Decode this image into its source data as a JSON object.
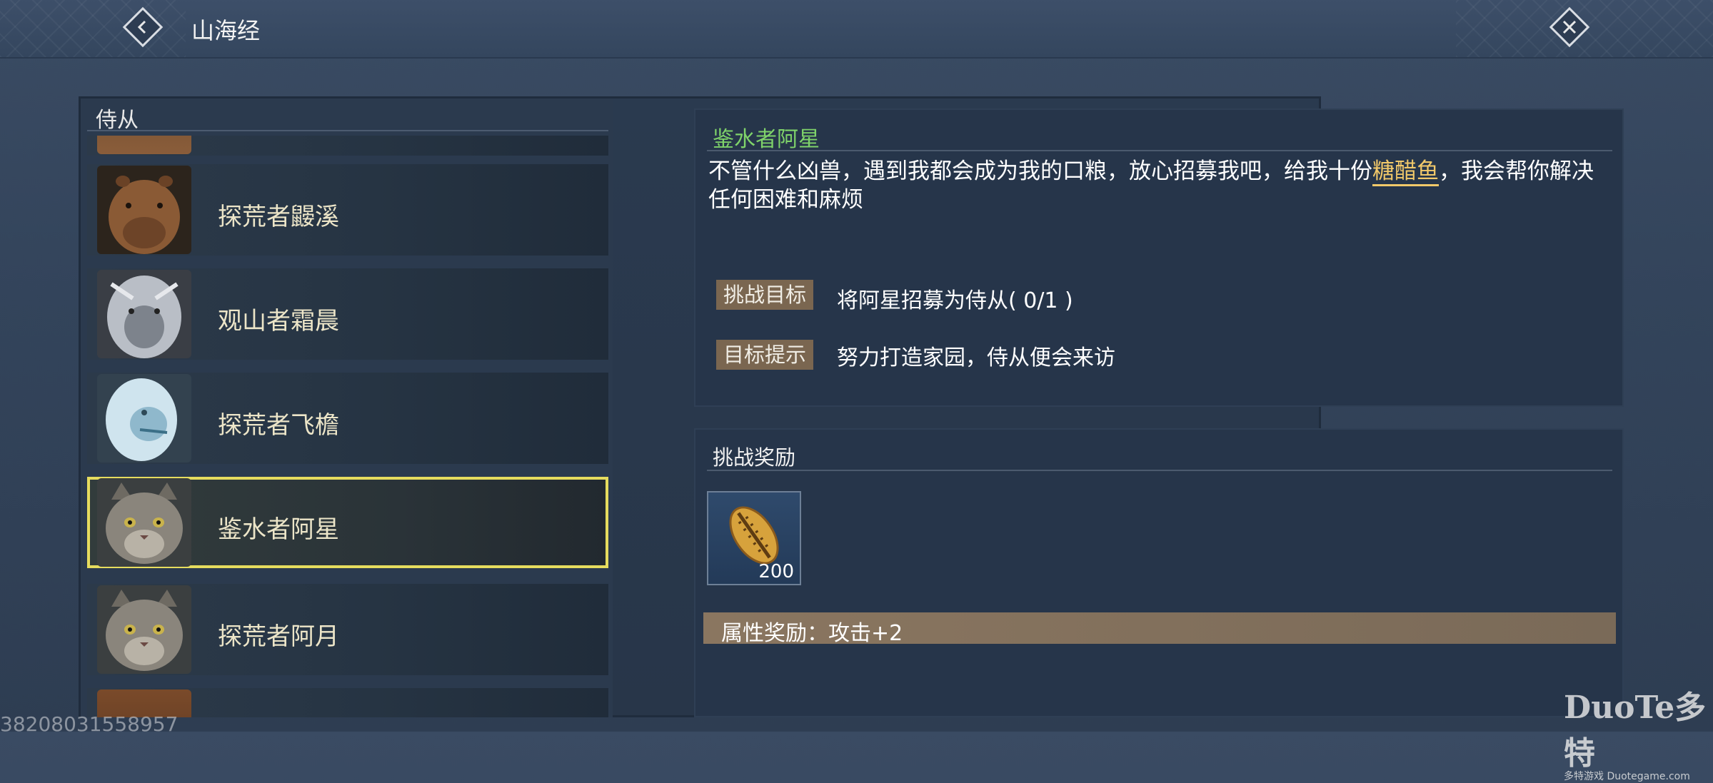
{
  "header": {
    "title": "山海经"
  },
  "sidebar": {
    "heading": "侍从",
    "items": [
      {
        "label": "探荒者鼹溪",
        "portrait": "capybara"
      },
      {
        "label": "观山者霜晨",
        "portrait": "white-beast"
      },
      {
        "label": "探荒者飞檐",
        "portrait": "ice-beast"
      },
      {
        "label": "鉴水者阿星",
        "portrait": "cat",
        "selected": true
      },
      {
        "label": "探荒者阿月",
        "portrait": "cat"
      }
    ]
  },
  "detail": {
    "name": "鉴水者阿星",
    "desc_before": "不管什么凶兽，遇到我都会成为我的口粮，放心招募我吧，给我十份",
    "desc_highlight": "糖醋鱼",
    "desc_after": "，我会帮你解决任何困难和麻烦",
    "challenge_tag": "挑战目标",
    "challenge_text": "将阿星招募为侍从( 0/1 )",
    "hint_tag": "目标提示",
    "hint_text": "努力打造家园，侍从便会来访"
  },
  "reward": {
    "heading": "挑战奖励",
    "item_count": "200",
    "item_icon": "shell-icon",
    "attr_text": "属性奖励：攻击+2"
  },
  "watermark": {
    "number": "38208031558957",
    "logo": "DuoTe多特",
    "logo_sub": "多特游戏 Duotegame.com"
  },
  "colors": {
    "accent_green": "#7fd36a",
    "highlight_gold": "#f2c96a",
    "selected_border": "#e6dc5e",
    "tag_bg": "#7a6650"
  }
}
